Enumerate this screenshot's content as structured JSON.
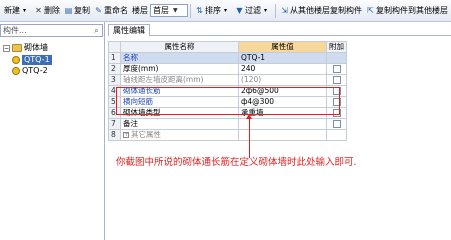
{
  "toolbar": {
    "new_label": "新建",
    "delete_label": "删除",
    "copy_label": "复制",
    "rename_label": "重命名",
    "floor_label": "楼层",
    "floor_value": "首层",
    "sort_label": "排序",
    "filter_label": "过滤",
    "copy_from_other_floors_label": "从其他楼层复制构件",
    "copy_to_other_floors_label": "复制构件到其他楼层"
  },
  "tree": {
    "search_placeholder": "构件...",
    "category_label": "砌体墙",
    "items": [
      {
        "label": "QTQ-1",
        "selected": true
      },
      {
        "label": "QTQ-2",
        "selected": false
      }
    ]
  },
  "property_tab": {
    "label": "属性编辑"
  },
  "property_table": {
    "headers": [
      "",
      "属性名称",
      "属性值",
      "附加"
    ],
    "rows": [
      {
        "num": "1",
        "name": "名称",
        "value": "QTQ-1",
        "style": "blue",
        "checkbox": false
      },
      {
        "num": "2",
        "name": "厚度(mm)",
        "value": "240",
        "style": "normal",
        "checkbox": true
      },
      {
        "num": "3",
        "name": "轴线距左墙皮距离(mm)",
        "value": "(120)",
        "style": "gray",
        "checkbox": true
      },
      {
        "num": "4",
        "name": "砌体通长筋",
        "value": "2ф6@500",
        "style": "blue",
        "checkbox": true
      },
      {
        "num": "5",
        "name": "横向短筋",
        "value": "ф4@300",
        "style": "blue",
        "checkbox": true
      },
      {
        "num": "6",
        "name": "砌体墙类型",
        "value": "承重墙",
        "style": "normal",
        "checkbox": true
      },
      {
        "num": "7",
        "name": "备注",
        "value": "",
        "style": "normal",
        "checkbox": true
      },
      {
        "num": "8",
        "name": "其它属性",
        "value": "",
        "style": "group",
        "checkbox": false
      }
    ]
  },
  "annotation": {
    "note": "你截图中所说的砌体通长筋在定义砌体墙时此处输入即可.",
    "color": "#e02020"
  }
}
